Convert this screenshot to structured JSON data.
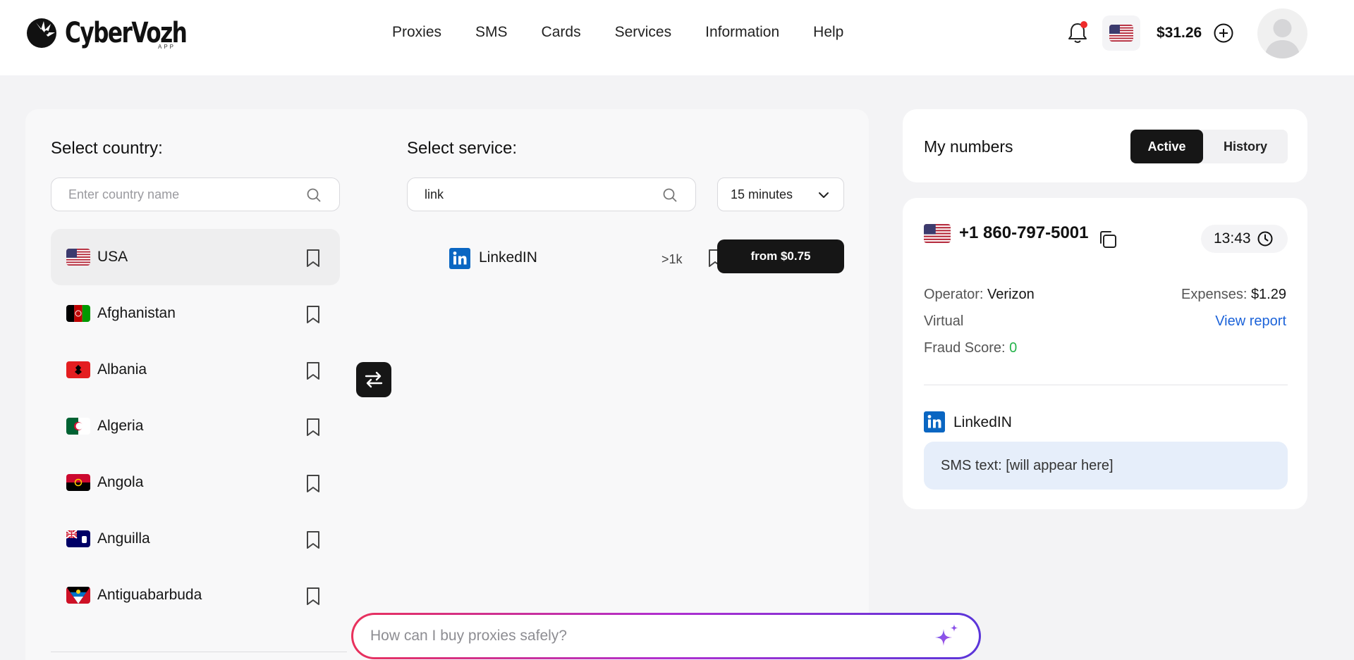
{
  "header": {
    "logo_text": "CyberVozh",
    "logo_sub": "APP",
    "nav": [
      "Proxies",
      "SMS",
      "Cards",
      "Services",
      "Information",
      "Help"
    ],
    "balance": "$31.26",
    "selected_flag": "us-flag"
  },
  "country_panel": {
    "title": "Select country:",
    "search_placeholder": "Enter country name",
    "countries": [
      {
        "name": "USA",
        "flag": "us-flag",
        "active": true
      },
      {
        "name": "Afghanistan",
        "flag": "af-flag"
      },
      {
        "name": "Albania",
        "flag": "al-flag"
      },
      {
        "name": "Algeria",
        "flag": "dz-flag"
      },
      {
        "name": "Angola",
        "flag": "ao-flag"
      },
      {
        "name": "Anguilla",
        "flag": "ai-flag"
      },
      {
        "name": "Antiguabarbuda",
        "flag": "ag-flag"
      }
    ]
  },
  "service_panel": {
    "title": "Select service:",
    "search_value": "link",
    "duration": "15 minutes",
    "services": [
      {
        "name": "LinkedIN",
        "count": ">1k",
        "price_label": "from $0.75",
        "icon": "linkedin-icon"
      }
    ]
  },
  "my_numbers": {
    "title": "My numbers",
    "tabs": [
      {
        "label": "Active",
        "active": true
      },
      {
        "label": "History",
        "active": false
      }
    ],
    "number": {
      "phone": "+1 860-797-5001",
      "timer": "13:43",
      "operator_label": "Operator:",
      "operator": "Verizon",
      "expenses_label": "Expenses:",
      "expenses": "$1.29",
      "type": "Virtual",
      "view_report": "View report",
      "fraud_label": "Fraud Score:",
      "fraud_score": "0",
      "service": "LinkedIN",
      "sms_text": "SMS text: [will appear here]"
    }
  },
  "ai_bar": {
    "placeholder": "How can I buy proxies safely?"
  },
  "colors": {
    "accent_dark": "#161616",
    "link_blue": "#1c63d9",
    "fraud_green": "#25b34b",
    "linkedin_blue": "#0a66c2",
    "notification_red": "#ee2b2b"
  }
}
